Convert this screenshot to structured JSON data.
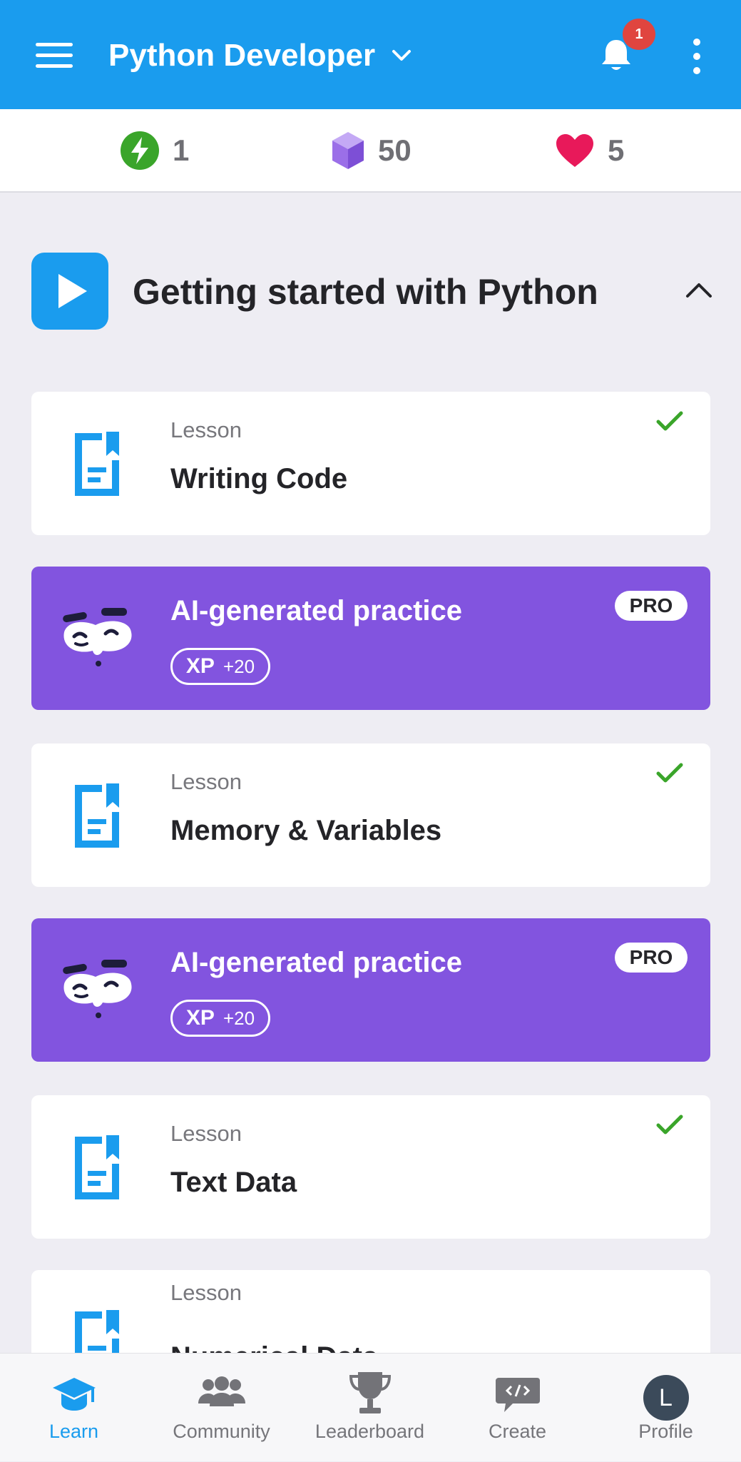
{
  "header": {
    "title": "Python Developer",
    "notification_count": "1",
    "accent_color": "#1a9cee"
  },
  "stats": {
    "streak": "1",
    "gems": "50",
    "hearts": "5"
  },
  "section": {
    "title": "Getting started with Python"
  },
  "cards": [
    {
      "type": "lesson",
      "kicker": "Lesson",
      "title": "Writing Code",
      "completed": true
    },
    {
      "type": "ai",
      "title": "AI-generated practice",
      "xp_label": "XP",
      "xp_amount": "+20",
      "badge": "PRO"
    },
    {
      "type": "lesson",
      "kicker": "Lesson",
      "title": "Memory & Variables",
      "completed": true
    },
    {
      "type": "ai",
      "title": "AI-generated practice",
      "xp_label": "XP",
      "xp_amount": "+20",
      "badge": "PRO"
    },
    {
      "type": "lesson",
      "kicker": "Lesson",
      "title": "Text Data",
      "completed": true
    },
    {
      "type": "lesson",
      "kicker": "Lesson",
      "title": "Numerical Data",
      "completed": false
    }
  ],
  "nav": [
    {
      "label": "Learn",
      "icon": "graduation-cap-icon",
      "active": true
    },
    {
      "label": "Community",
      "icon": "people-icon",
      "active": false
    },
    {
      "label": "Leaderboard",
      "icon": "trophy-icon",
      "active": false
    },
    {
      "label": "Create",
      "icon": "code-bubble-icon",
      "active": false
    },
    {
      "label": "Profile",
      "icon": "avatar",
      "active": false,
      "avatar_initial": "L"
    }
  ],
  "colors": {
    "ai_card": "#8254df",
    "check": "#3aa52a",
    "heart": "#e8195a",
    "gem": "#9b6fe8"
  }
}
